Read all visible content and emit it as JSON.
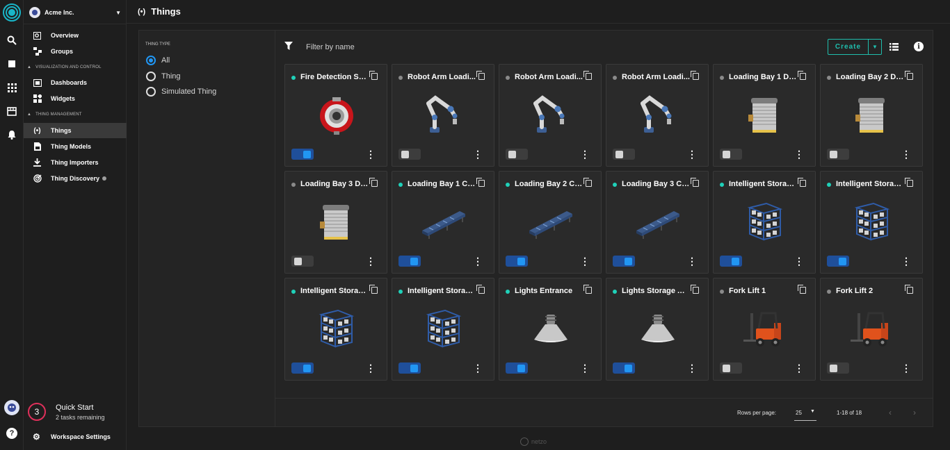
{
  "org": {
    "name": "Acme Inc."
  },
  "topbar": {
    "title": "Things"
  },
  "nav": {
    "overview": "Overview",
    "groups": "Groups",
    "section_viz": "VISUALIZATION AND CONTROL",
    "dashboards": "Dashboards",
    "widgets": "Widgets",
    "section_thing": "THING MANAGEMENT",
    "things": "Things",
    "thing_models": "Thing Models",
    "thing_importers": "Thing Importers",
    "thing_discovery": "Thing Discovery"
  },
  "quick_start": {
    "count": "3",
    "title": "Quick Start",
    "subtitle": "2 tasks remaining"
  },
  "workspace_settings": "Workspace Settings",
  "filters": {
    "title": "THING TYPE",
    "options": [
      {
        "label": "All",
        "selected": true
      },
      {
        "label": "Thing",
        "selected": false
      },
      {
        "label": "Simulated Thing",
        "selected": false
      }
    ]
  },
  "toolbar": {
    "filter_placeholder": "Filter by name",
    "create_label": "Create"
  },
  "colors": {
    "online": "#1fd1b9",
    "offline": "#8a8a8a",
    "accent": "#1fbfae",
    "toggle_on": "#2196f3"
  },
  "things": [
    {
      "name": "Fire Detection Sy...",
      "online": true,
      "enabled": true,
      "icon": "fire-detector-icon"
    },
    {
      "name": "Robot Arm Loadi...",
      "online": false,
      "enabled": false,
      "icon": "robot-arm-icon"
    },
    {
      "name": "Robot Arm Loadi...",
      "online": false,
      "enabled": false,
      "icon": "robot-arm-icon"
    },
    {
      "name": "Robot Arm Loadi...",
      "online": false,
      "enabled": false,
      "icon": "robot-arm-icon"
    },
    {
      "name": "Loading Bay 1 Door",
      "online": false,
      "enabled": false,
      "icon": "rolling-door-icon"
    },
    {
      "name": "Loading Bay 2 Door",
      "online": false,
      "enabled": false,
      "icon": "rolling-door-icon"
    },
    {
      "name": "Loading Bay 3 Door",
      "online": false,
      "enabled": false,
      "icon": "rolling-door-icon"
    },
    {
      "name": "Loading Bay 1 Co...",
      "online": true,
      "enabled": true,
      "icon": "conveyor-icon"
    },
    {
      "name": "Loading Bay 2 Co...",
      "online": true,
      "enabled": true,
      "icon": "conveyor-icon"
    },
    {
      "name": "Loading Bay 3 Co...",
      "online": true,
      "enabled": true,
      "icon": "conveyor-icon"
    },
    {
      "name": "Intelligent Storag...",
      "online": true,
      "enabled": true,
      "icon": "storage-rack-icon"
    },
    {
      "name": "Intelligent Storag...",
      "online": true,
      "enabled": true,
      "icon": "storage-rack-icon"
    },
    {
      "name": "Intelligent Storag...",
      "online": true,
      "enabled": true,
      "icon": "storage-rack-icon"
    },
    {
      "name": "Intelligent Storag...",
      "online": true,
      "enabled": true,
      "icon": "storage-rack-icon"
    },
    {
      "name": "Lights Entrance",
      "online": true,
      "enabled": true,
      "icon": "ceiling-light-icon"
    },
    {
      "name": "Lights Storage Ar...",
      "online": true,
      "enabled": true,
      "icon": "ceiling-light-icon"
    },
    {
      "name": "Fork Lift 1",
      "online": false,
      "enabled": false,
      "icon": "forklift-icon"
    },
    {
      "name": "Fork Lift 2",
      "online": false,
      "enabled": false,
      "icon": "forklift-icon"
    }
  ],
  "pagination": {
    "rows_per_page_label": "Rows per page:",
    "rows_per_page": "25",
    "range": "1-18 of 18"
  },
  "footer": {
    "brand": "netzo"
  }
}
